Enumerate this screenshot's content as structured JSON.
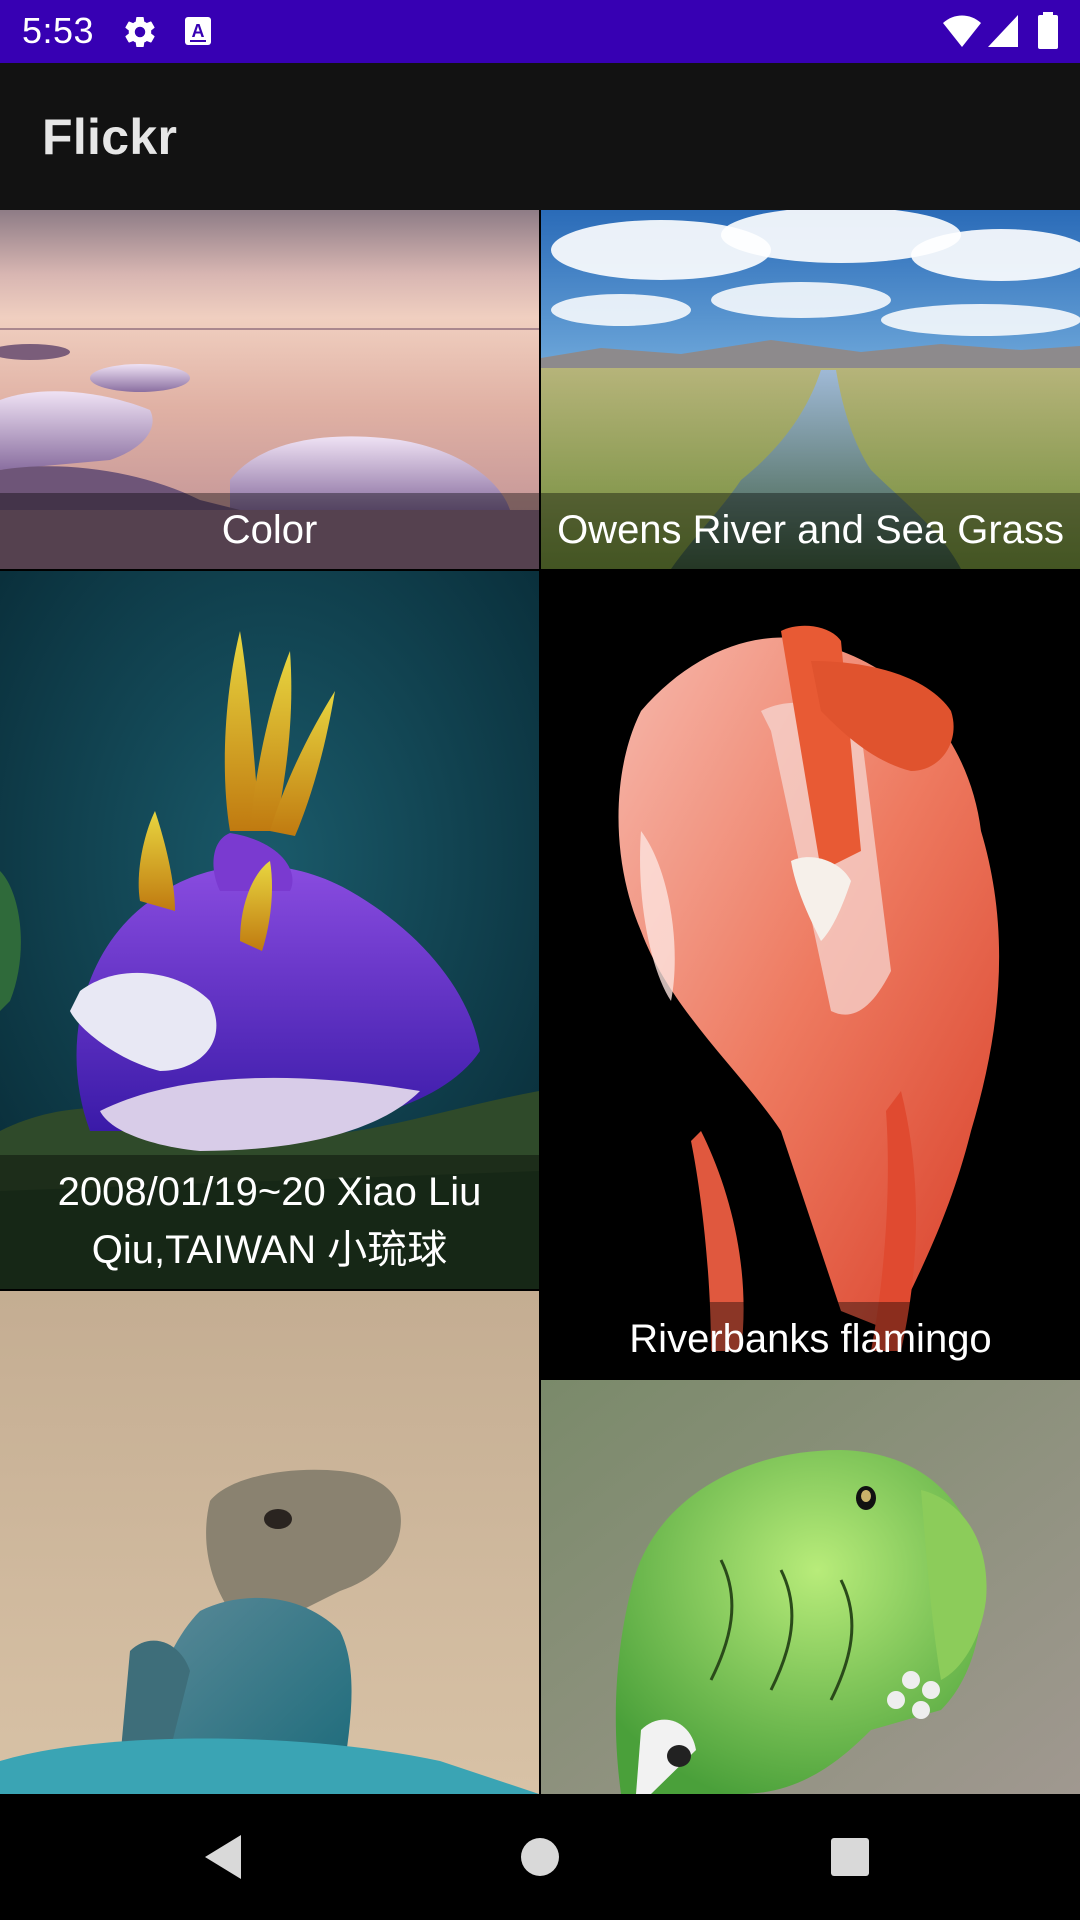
{
  "status_bar": {
    "time": "5:53",
    "icons": [
      "gear-icon",
      "keyboard-a-icon",
      "wifi-icon",
      "signal-icon",
      "battery-icon"
    ],
    "background": "#3700b3"
  },
  "app_bar": {
    "title": "Flickr",
    "background": "#121212"
  },
  "photos": [
    {
      "title": "Color",
      "thumbnail": "sunset-icy-shore"
    },
    {
      "title": "Owens River and Sea Grass",
      "thumbnail": "river-landscape"
    },
    {
      "title": "2008/01/19~20 Xiao Liu Qiu,TAIWAN 小琉球",
      "thumbnail": "purple-nudibranch"
    },
    {
      "title": "Riverbanks flamingo",
      "thumbnail": "pink-flamingo"
    },
    {
      "title": "",
      "thumbnail": "blue-lizard"
    },
    {
      "title": "",
      "thumbnail": "green-caterpillar"
    }
  ],
  "nav_bar": {
    "icons": [
      "back-icon",
      "home-icon",
      "recents-icon"
    ]
  }
}
